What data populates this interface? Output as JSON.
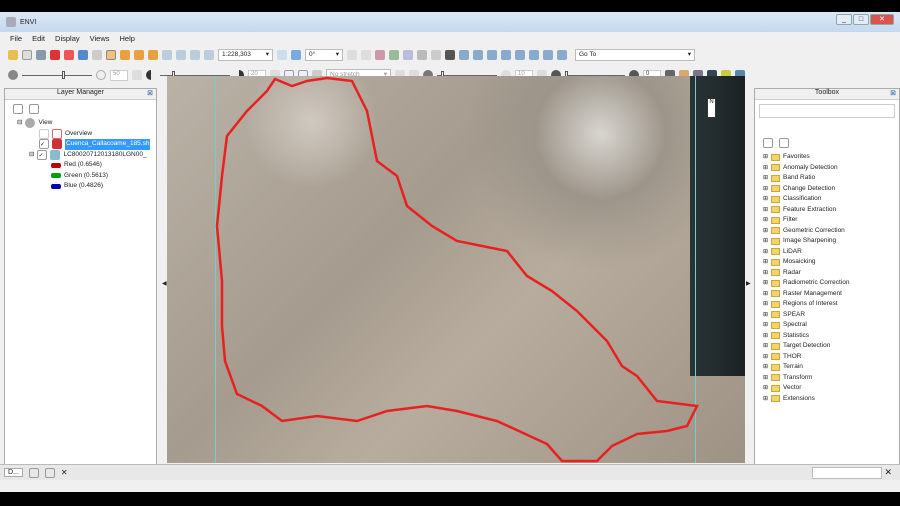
{
  "window": {
    "title": "ENVI"
  },
  "menu": [
    "File",
    "Edit",
    "Display",
    "Views",
    "Help"
  ],
  "toolbar": {
    "zoom_scale": "1:228,303",
    "rotation": "0°",
    "goto": "Go To"
  },
  "toolbar2": {
    "brightness": "50",
    "contrast": "20",
    "stretch": "No stretch",
    "sharpen": "10",
    "transparency": "0"
  },
  "layer_manager": {
    "title": "Layer Manager",
    "root": "View",
    "overview": "Overview",
    "vector_layer": "Cuenca_Callacoame_185.sh",
    "raster_layer": "LC80020712013180LGN00_",
    "bands": [
      {
        "label": "Red (0.6546)",
        "color": "#c00000"
      },
      {
        "label": "Green (0.5613)",
        "color": "#00a000"
      },
      {
        "label": "Blue (0.4826)",
        "color": "#0000b0"
      }
    ]
  },
  "toolbox": {
    "title": "Toolbox",
    "search_value": "",
    "items": [
      "Favorites",
      "Anomaly Detection",
      "Band Ratio",
      "Change Detection",
      "Classification",
      "Feature Extraction",
      "Filter",
      "Geometric Correction",
      "Image Sharpening",
      "LiDAR",
      "Mosaicking",
      "Radar",
      "Radiometric Correction",
      "Raster Management",
      "Regions of Interest",
      "SPEAR",
      "Spectral",
      "Statistics",
      "Target Detection",
      "THOR",
      "Terrain",
      "Transform",
      "Vector",
      "Extensions"
    ]
  },
  "taskbar": {
    "item": "D..."
  }
}
